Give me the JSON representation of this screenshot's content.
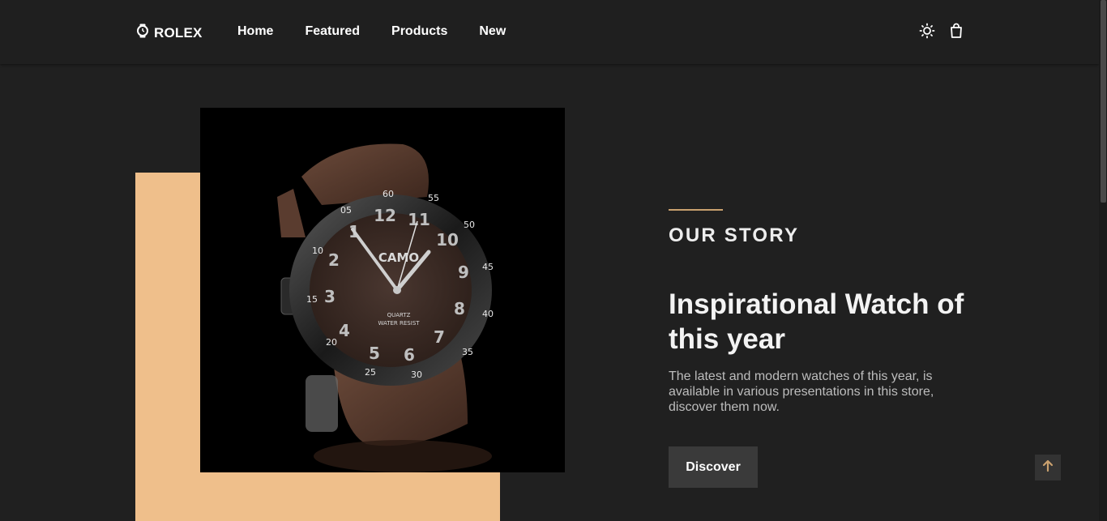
{
  "brand": {
    "name": "ROLEX",
    "icon": "watch-icon"
  },
  "nav": {
    "items": [
      {
        "label": "Home"
      },
      {
        "label": "Featured"
      },
      {
        "label": "Products"
      },
      {
        "label": "New"
      }
    ]
  },
  "header_actions": {
    "theme_icon": "sun-icon",
    "cart_icon": "shopping-bag-icon"
  },
  "hero": {
    "kicker": "OUR STORY",
    "headline": "Inspirational Watch of this year",
    "description": "The latest and modern watches of this year, is available in various presentations in this store, discover them now.",
    "button_label": "Discover",
    "watch_dial_text": {
      "brand": "CAMO",
      "line1": "QUARTZ",
      "line2": "WATER RESIST"
    },
    "numerals": [
      "12",
      "11",
      "10",
      "9",
      "8",
      "7",
      "6",
      "5",
      "4",
      "3",
      "2",
      "1"
    ],
    "bezel": [
      "60",
      "55",
      "50",
      "45",
      "40",
      "35",
      "30",
      "25",
      "20",
      "15",
      "10",
      "05"
    ]
  },
  "colors": {
    "background": "#202020",
    "accent_block": "#efbf8b",
    "accent_line": "#c9a06e",
    "button_bg": "#3a3a3a",
    "scroll_top_arrow": "#c9a06e"
  },
  "scroll_top": {
    "icon": "arrow-up-icon"
  }
}
